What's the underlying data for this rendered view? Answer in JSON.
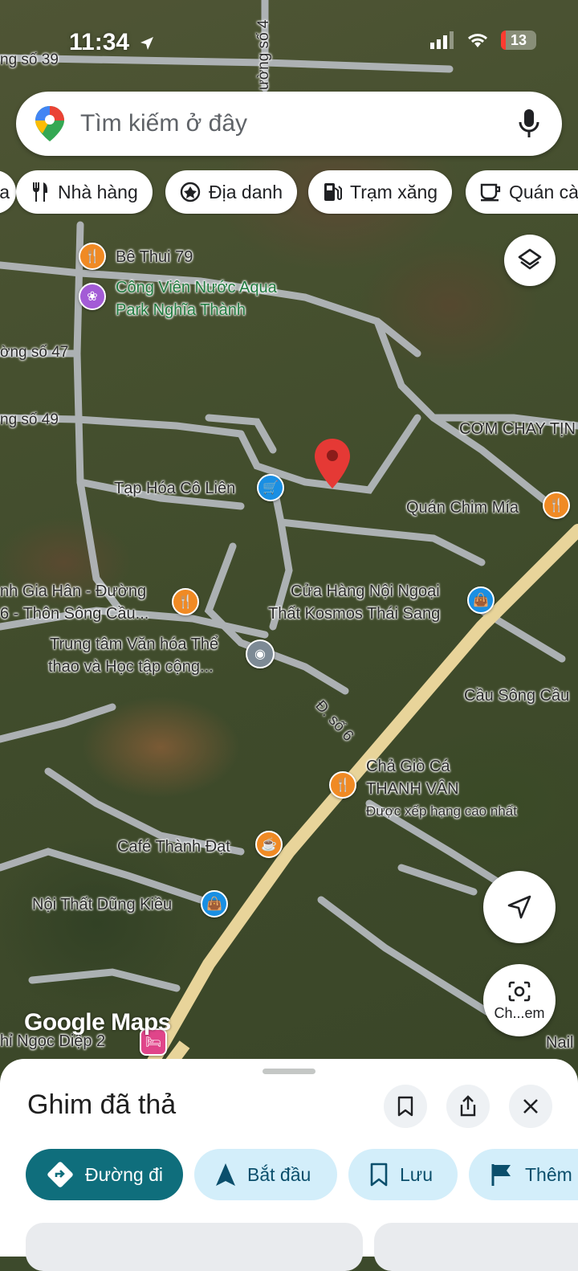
{
  "status_bar": {
    "time": "11:34",
    "battery": "13"
  },
  "search": {
    "placeholder": "Tìm kiếm ở đây"
  },
  "chips": [
    {
      "label": "ga",
      "icon": "none"
    },
    {
      "label": "Nhà hàng",
      "icon": "restaurant-icon"
    },
    {
      "label": "Địa danh",
      "icon": "landmark-icon"
    },
    {
      "label": "Trạm xăng",
      "icon": "gas-station-icon"
    },
    {
      "label": "Quán cà",
      "icon": "cafe-icon"
    }
  ],
  "map": {
    "roads": [
      "ng số 39",
      "ường số 4",
      "ờng số 47",
      "ng số 49",
      "Đ. số 6"
    ],
    "places": [
      {
        "name": "Bê Thui 79",
        "type": "restaurant"
      },
      {
        "name": "Công Viên Nước Aqua",
        "name2": "Park Nghĩa Thành",
        "type": "park"
      },
      {
        "name": "CƠM CHAY TỊN",
        "type": "label"
      },
      {
        "name": "Tạp Hóa Cô Liên",
        "type": "shop"
      },
      {
        "name": "Quán Chim Mía",
        "type": "restaurant"
      },
      {
        "name": "nh Gia Hân - Đường",
        "name2": "6 - Thôn Sông Cầu...",
        "type": "restaurant"
      },
      {
        "name": "Cửa Hàng Nội Ngoại",
        "name2": "Thất Kosmos Thái Sang",
        "type": "store"
      },
      {
        "name": "Trung tâm Văn hóa Thể",
        "name2": "thao và Học tập cộng...",
        "type": "place"
      },
      {
        "name": "Cầu Sông Cầu",
        "type": "label"
      },
      {
        "name": "Chả Giò Cá",
        "name2": "THANH VÂN",
        "note": "Được xếp hạng cao nhất",
        "type": "restaurant"
      },
      {
        "name": "Café Thành Đạt",
        "type": "cafe"
      },
      {
        "name": "Nội Thất Dũng Kiều",
        "type": "store"
      },
      {
        "name": "hỉ Ngọc Diệp 2",
        "type": "hotel"
      },
      {
        "name": "Nail",
        "type": "label"
      }
    ],
    "logo": "Google Maps",
    "lens_label": "Ch...em"
  },
  "sheet": {
    "title": "Ghim đã thả",
    "actions": [
      {
        "label": "Đường đi",
        "icon": "directions-icon"
      },
      {
        "label": "Bắt đầu",
        "icon": "navigation-arrow-icon"
      },
      {
        "label": "Lưu",
        "icon": "bookmark-icon"
      },
      {
        "label": "Thêm",
        "icon": "flag-icon"
      }
    ]
  },
  "colors": {
    "pin_red": "#e53935",
    "primary_action": "#0f6e7c",
    "secondary_action": "#d3eefa",
    "main_road": "#e8d49a"
  }
}
